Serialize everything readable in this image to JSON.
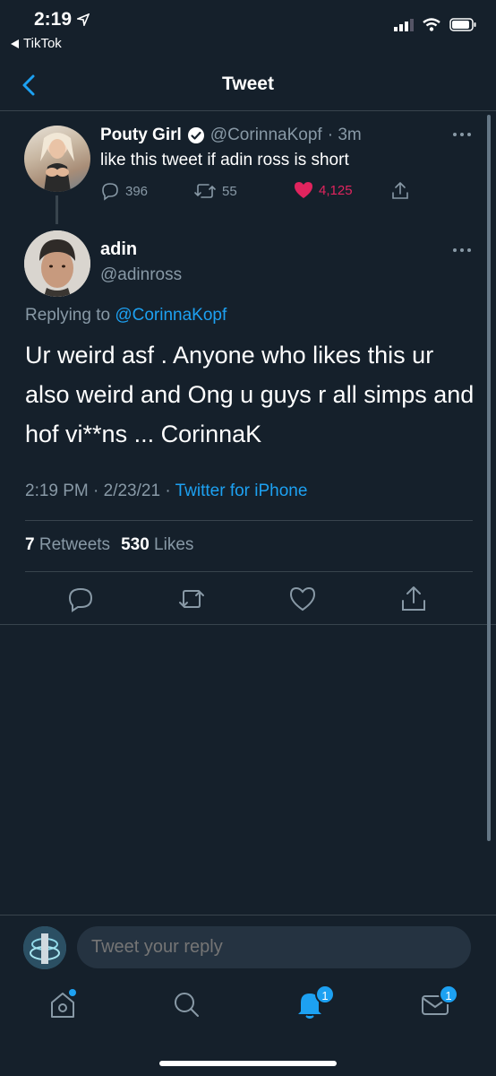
{
  "status_bar": {
    "time": "2:19",
    "back_app": "TikTok"
  },
  "nav": {
    "title": "Tweet"
  },
  "parent_tweet": {
    "name": "Pouty Girl",
    "handle": "@CorinnaKopf",
    "time": "· 3m",
    "text": "like this tweet if adin ross is short",
    "replies": "396",
    "retweets": "55",
    "likes": "4,125"
  },
  "tweet": {
    "name": "adin",
    "handle": "@adinross",
    "replying_prefix": "Replying to",
    "replying_to": "@CorinnaKopf",
    "text": "Ur weird asf . Anyone who likes this ur also weird and Ong u guys r all simps and hof vi**ns ... CorinnaK",
    "timestamp": "2:19 PM · 2/23/21 ·",
    "source": "Twitter for iPhone",
    "retweets_count": "7",
    "retweets_label": "Retweets",
    "likes_count": "530",
    "likes_label": "Likes"
  },
  "reply_bar": {
    "placeholder": "Tweet your reply"
  },
  "tabbar": {
    "notifications_badge": "1",
    "messages_badge": "1"
  },
  "colors": {
    "background": "#15202b",
    "accent": "#1da1f2",
    "like": "#e0245e",
    "muted": "#8899a6",
    "divider": "#38444d"
  }
}
